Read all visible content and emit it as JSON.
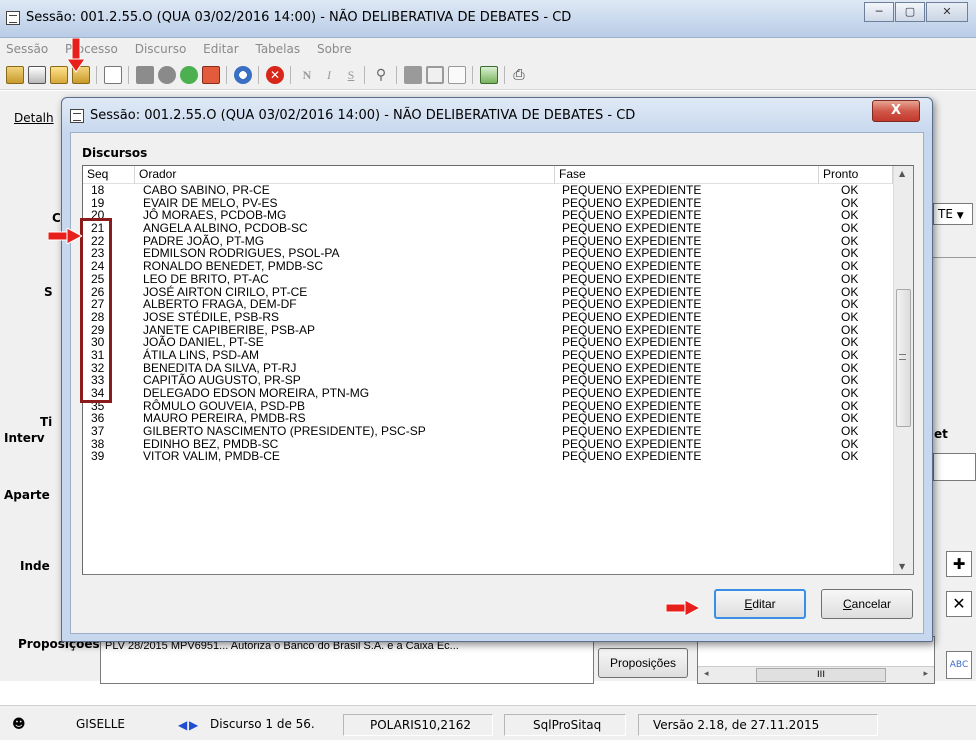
{
  "main_window": {
    "title": "Sessão: 001.2.55.O (QUA 03/02/2016 14:00) - NÃO DELIBERATIVA DE DEBATES - CD",
    "buttons": {
      "minimize": "─",
      "maximize": "▢",
      "close": "✕"
    }
  },
  "menu": [
    {
      "label": "Sessão"
    },
    {
      "label": "Processo"
    },
    {
      "label": "Discurso"
    },
    {
      "label": "Editar"
    },
    {
      "label": "Tabelas"
    },
    {
      "label": "Sobre"
    }
  ],
  "background_form": {
    "tab_detalhes": "Detalh",
    "label_te": "TE",
    "label_tipo": "Ti",
    "label_intervencao": "Interv",
    "label_aparte": "Aparte",
    "label_indexacao": "Inde",
    "label_proposicoes": "Proposições",
    "proposicoes_value": "PLV 28/2015 MPV6951...   Autoriza o Banco do Brasil S.A. e a Caixa Ec...",
    "proposicoes_button": "Proposições",
    "scroll_mid": "III"
  },
  "status_bar": {
    "user": "GISELLE",
    "discourse": "Discurso 1 de 56.",
    "server": "POLARIS10,2162",
    "db": "SqlProSitaq",
    "version": "Versão 2.18, de 27.11.2015"
  },
  "dialog": {
    "title": "Sessão: 001.2.55.O (QUA 03/02/2016 14:00) - NÃO DELIBERATIVA DE DEBATES - CD",
    "close_label": "X",
    "section_title": "Discursos",
    "columns": {
      "seq": "Seq",
      "orador": "Orador",
      "fase": "Fase",
      "pronto": "Pronto"
    },
    "rows": [
      {
        "seq": "18",
        "orador": "CABO SABINO, PR-CE",
        "fase": "PEQUENO EXPEDIENTE",
        "pronto": "OK"
      },
      {
        "seq": "19",
        "orador": "EVAIR DE MELO, PV-ES",
        "fase": "PEQUENO EXPEDIENTE",
        "pronto": "OK"
      },
      {
        "seq": "20",
        "orador": "JÔ MORAES, PCDOB-MG",
        "fase": "PEQUENO EXPEDIENTE",
        "pronto": "OK"
      },
      {
        "seq": "21",
        "orador": "ANGELA ALBINO, PCDOB-SC",
        "fase": "PEQUENO EXPEDIENTE",
        "pronto": "OK"
      },
      {
        "seq": "22",
        "orador": "PADRE JOÃO, PT-MG",
        "fase": "PEQUENO EXPEDIENTE",
        "pronto": "OK"
      },
      {
        "seq": "23",
        "orador": "EDMILSON RODRIGUES, PSOL-PA",
        "fase": "PEQUENO EXPEDIENTE",
        "pronto": "OK"
      },
      {
        "seq": "24",
        "orador": "RONALDO BENEDET, PMDB-SC",
        "fase": "PEQUENO EXPEDIENTE",
        "pronto": "OK"
      },
      {
        "seq": "25",
        "orador": "LEO DE BRITO, PT-AC",
        "fase": "PEQUENO EXPEDIENTE",
        "pronto": "OK"
      },
      {
        "seq": "26",
        "orador": "JOSÉ AIRTON CIRILO, PT-CE",
        "fase": "PEQUENO EXPEDIENTE",
        "pronto": "OK"
      },
      {
        "seq": "27",
        "orador": "ALBERTO FRAGA, DEM-DF",
        "fase": "PEQUENO EXPEDIENTE",
        "pronto": "OK"
      },
      {
        "seq": "28",
        "orador": "JOSE STÉDILE, PSB-RS",
        "fase": "PEQUENO EXPEDIENTE",
        "pronto": "OK"
      },
      {
        "seq": "29",
        "orador": "JANETE CAPIBERIBE, PSB-AP",
        "fase": "PEQUENO EXPEDIENTE",
        "pronto": "OK"
      },
      {
        "seq": "30",
        "orador": "JOÃO DANIEL, PT-SE",
        "fase": "PEQUENO EXPEDIENTE",
        "pronto": "OK"
      },
      {
        "seq": "31",
        "orador": "ÁTILA LINS, PSD-AM",
        "fase": "PEQUENO EXPEDIENTE",
        "pronto": "OK"
      },
      {
        "seq": "32",
        "orador": "BENEDITA DA SILVA, PT-RJ",
        "fase": "PEQUENO EXPEDIENTE",
        "pronto": "OK"
      },
      {
        "seq": "33",
        "orador": "CAPITÃO AUGUSTO, PR-SP",
        "fase": "PEQUENO EXPEDIENTE",
        "pronto": "OK"
      },
      {
        "seq": "34",
        "orador": "DELEGADO EDSON MOREIRA, PTN-MG",
        "fase": "PEQUENO EXPEDIENTE",
        "pronto": "OK"
      },
      {
        "seq": "35",
        "orador": "RÔMULO GOUVEIA, PSD-PB",
        "fase": "PEQUENO EXPEDIENTE",
        "pronto": "OK"
      },
      {
        "seq": "36",
        "orador": "MAURO PEREIRA, PMDB-RS",
        "fase": "PEQUENO EXPEDIENTE",
        "pronto": "OK"
      },
      {
        "seq": "37",
        "orador": "GILBERTO NASCIMENTO (PRESIDENTE), PSC-SP",
        "fase": "PEQUENO EXPEDIENTE",
        "pronto": "OK"
      },
      {
        "seq": "38",
        "orador": "EDINHO BEZ, PMDB-SC",
        "fase": "PEQUENO EXPEDIENTE",
        "pronto": "OK"
      },
      {
        "seq": "39",
        "orador": "VITOR VALIM, PMDB-CE",
        "fase": "PEQUENO EXPEDIENTE",
        "pronto": "OK"
      }
    ],
    "buttons": {
      "editar_first": "E",
      "editar_rest": "ditar",
      "cancelar_first": "C",
      "cancelar_rest": "ancelar"
    }
  },
  "colors": {
    "annotation_arrow": "#e8201c",
    "highlight_box": "#8b1a1a",
    "title_gradient": "#c7d7ec"
  }
}
